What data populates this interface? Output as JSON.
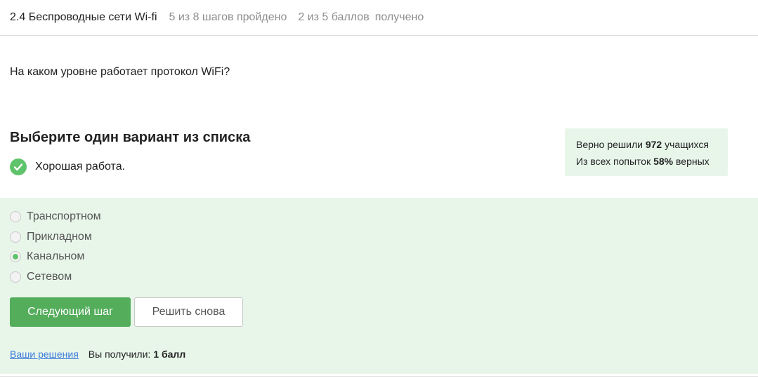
{
  "header": {
    "lesson_title": "2.4 Беспроводные сети Wi-fi",
    "steps_progress": "5 из 8 шагов пройдено",
    "score_progress": "2 из 5 баллов",
    "score_suffix": "получено"
  },
  "question": "На каком уровне работает протокол WiFi?",
  "task_title": "Выберите один вариант из списка",
  "feedback": "Хорошая работа.",
  "stats": {
    "line1_prefix": "Верно решили",
    "line1_value": "972",
    "line1_suffix": "учащихся",
    "line2_prefix": "Из всех попыток",
    "line2_value": "58%",
    "line2_suffix": "верных"
  },
  "options": [
    {
      "label": "Транспортном",
      "selected": false
    },
    {
      "label": "Прикладном",
      "selected": false
    },
    {
      "label": "Канальном",
      "selected": true
    },
    {
      "label": "Сетевом",
      "selected": false
    }
  ],
  "buttons": {
    "next": "Следующий шаг",
    "retry": "Решить снова"
  },
  "footer": {
    "solutions_link": "Ваши решения",
    "got_label": "Вы получили:",
    "got_value": "1 балл"
  },
  "colors": {
    "accent": "#54ad5b",
    "success": "#5fc36b",
    "answer_bg": "#e8f6ea",
    "link": "#3d7bd9"
  },
  "icons": {
    "feedback_icon": "check-circle-icon"
  }
}
